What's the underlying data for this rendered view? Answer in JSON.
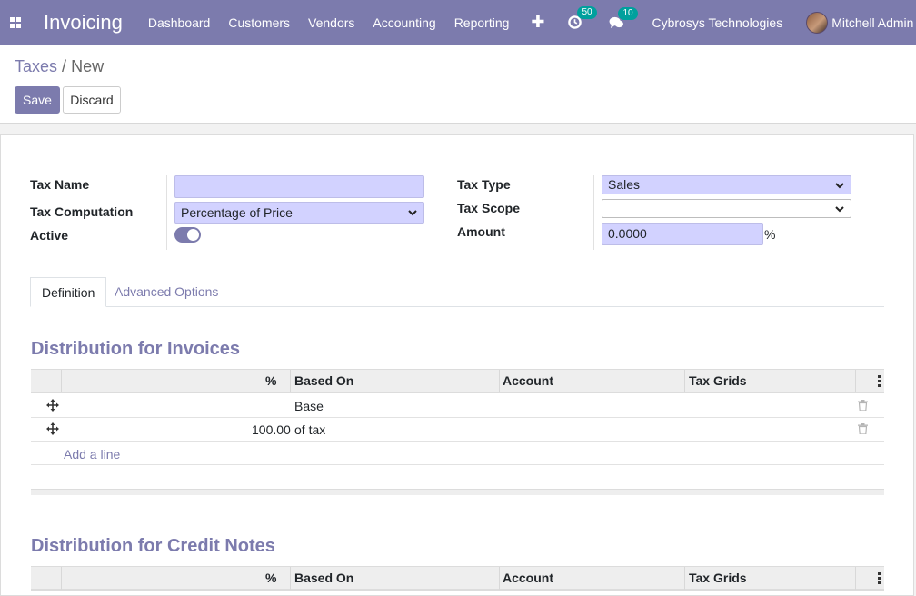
{
  "navbar": {
    "app_name": "Invoicing",
    "menu": [
      "Dashboard",
      "Customers",
      "Vendors",
      "Accounting",
      "Reporting"
    ],
    "activity_count": "50",
    "messages_count": "10",
    "company": "Cybrosys Technologies",
    "user": "Mitchell Admin"
  },
  "breadcrumb": {
    "parent": "Taxes",
    "separator": "/",
    "current": "New"
  },
  "buttons": {
    "save": "Save",
    "discard": "Discard"
  },
  "form": {
    "tax_name_label": "Tax Name",
    "tax_name_value": "",
    "tax_computation_label": "Tax Computation",
    "tax_computation_value": "Percentage of Price",
    "active_label": "Active",
    "active_value": true,
    "tax_type_label": "Tax Type",
    "tax_type_value": "Sales",
    "tax_scope_label": "Tax Scope",
    "tax_scope_value": "",
    "amount_label": "Amount",
    "amount_value": "0.0000",
    "amount_unit": "%"
  },
  "tabs": [
    {
      "label": "Definition",
      "active": true
    },
    {
      "label": "Advanced Options",
      "active": false
    }
  ],
  "invoices": {
    "title": "Distribution for Invoices",
    "columns": [
      "%",
      "Based On",
      "Account",
      "Tax Grids"
    ],
    "rows": [
      {
        "percent": "",
        "based_on": "Base",
        "account": "",
        "tax_grids": ""
      },
      {
        "percent": "100.00",
        "based_on": "of tax",
        "account": "",
        "tax_grids": ""
      }
    ],
    "add_line": "Add a line"
  },
  "credit_notes": {
    "title": "Distribution for Credit Notes",
    "columns": [
      "%",
      "Based On",
      "Account",
      "Tax Grids"
    ]
  },
  "colors": {
    "brand": "#7c7bad",
    "badge": "#00a09d",
    "field_bg": "#d2d2ff"
  }
}
